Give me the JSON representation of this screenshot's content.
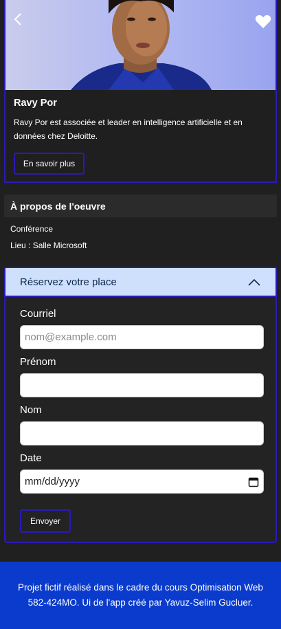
{
  "speaker": {
    "name": "Ravy Por",
    "bio": "Ravy Por est associée et leader en intelligence artificielle et en données chez Deloitte.",
    "learn_more_label": "En savoir plus",
    "back_icon": "chevron-left-icon",
    "favorite_icon": "heart-icon"
  },
  "about": {
    "title": "À propos de l'oeuvre",
    "type": "Conférence",
    "venue": "Lieu : Salle Microsoft"
  },
  "reservation": {
    "title": "Réservez votre place",
    "toggle_icon": "chevron-up-icon",
    "fields": {
      "email": {
        "label": "Courriel",
        "placeholder": "nom@example.com",
        "value": ""
      },
      "first_name": {
        "label": "Prénom",
        "value": ""
      },
      "last_name": {
        "label": "Nom",
        "value": ""
      },
      "date": {
        "label": "Date",
        "placeholder": "mm/dd/yyyy",
        "icon": "calendar-icon"
      }
    },
    "submit_label": "Envoyer"
  },
  "footer": {
    "text": "Projet fictif réalisé dans le cadre du cours Optimisation Web 582-424MO. Ui de l'app créé par Yavuz-Selim Gucluer."
  },
  "colors": {
    "background": "#202020",
    "accent_border": "#2a1bb5",
    "accordion_header": "#cfe0fc",
    "footer": "#0a3bcc"
  }
}
